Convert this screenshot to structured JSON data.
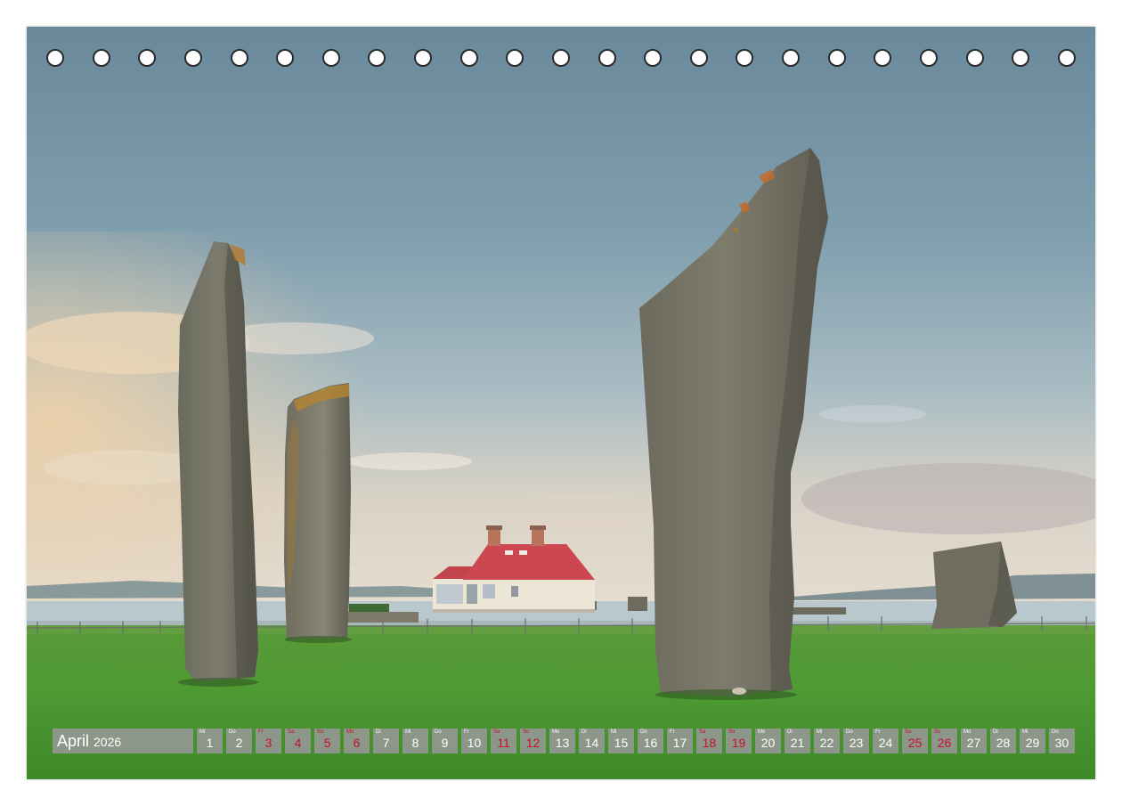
{
  "calendar": {
    "month": "April",
    "year": "2026",
    "accent_color": "#c8102e",
    "days": [
      {
        "wd": "Mi",
        "d": "1",
        "we": false
      },
      {
        "wd": "Do",
        "d": "2",
        "we": false
      },
      {
        "wd": "Fr",
        "d": "3",
        "we": true
      },
      {
        "wd": "Sa",
        "d": "4",
        "we": true
      },
      {
        "wd": "So",
        "d": "5",
        "we": true
      },
      {
        "wd": "Mo",
        "d": "6",
        "we": true
      },
      {
        "wd": "Di",
        "d": "7",
        "we": false
      },
      {
        "wd": "Mi",
        "d": "8",
        "we": false
      },
      {
        "wd": "Do",
        "d": "9",
        "we": false
      },
      {
        "wd": "Fr",
        "d": "10",
        "we": false
      },
      {
        "wd": "Sa",
        "d": "11",
        "we": true
      },
      {
        "wd": "So",
        "d": "12",
        "we": true
      },
      {
        "wd": "Mo",
        "d": "13",
        "we": false
      },
      {
        "wd": "Di",
        "d": "14",
        "we": false
      },
      {
        "wd": "Mi",
        "d": "15",
        "we": false
      },
      {
        "wd": "Do",
        "d": "16",
        "we": false
      },
      {
        "wd": "Fr",
        "d": "17",
        "we": false
      },
      {
        "wd": "Sa",
        "d": "18",
        "we": true
      },
      {
        "wd": "So",
        "d": "19",
        "we": true
      },
      {
        "wd": "Mo",
        "d": "20",
        "we": false
      },
      {
        "wd": "Di",
        "d": "21",
        "we": false
      },
      {
        "wd": "Mi",
        "d": "22",
        "we": false
      },
      {
        "wd": "Do",
        "d": "23",
        "we": false
      },
      {
        "wd": "Fr",
        "d": "24",
        "we": false
      },
      {
        "wd": "Sa",
        "d": "25",
        "we": true
      },
      {
        "wd": "So",
        "d": "26",
        "we": true
      },
      {
        "wd": "Mo",
        "d": "27",
        "we": false
      },
      {
        "wd": "Di",
        "d": "28",
        "we": false
      },
      {
        "wd": "Mi",
        "d": "29",
        "we": false
      },
      {
        "wd": "Do",
        "d": "30",
        "we": false
      }
    ]
  },
  "binding": {
    "hole_count": 23
  }
}
